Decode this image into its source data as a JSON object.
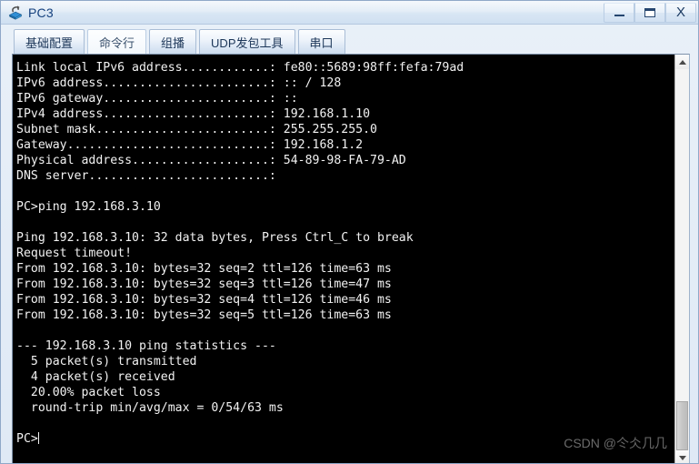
{
  "window": {
    "title": "PC3",
    "icon": "pc-device-icon",
    "controls": [
      {
        "name": "minimize-button",
        "label": "–",
        "icon": "minimize-icon"
      },
      {
        "name": "maximize-button",
        "label": "▭",
        "icon": "maximize-icon"
      },
      {
        "name": "close-button",
        "label": "X",
        "icon": "close-icon"
      }
    ]
  },
  "tabs": [
    {
      "label": "基础配置",
      "selected": false
    },
    {
      "label": "命令行",
      "selected": true
    },
    {
      "label": "组播",
      "selected": false
    },
    {
      "label": "UDP发包工具",
      "selected": false
    },
    {
      "label": "串口",
      "selected": false
    }
  ],
  "terminal": {
    "background": "#000000",
    "foreground": "#f2f2f2",
    "lines": [
      "Link local IPv6 address............: fe80::5689:98ff:fefa:79ad",
      "IPv6 address.......................: :: / 128",
      "IPv6 gateway.......................: ::",
      "IPv4 address.......................: 192.168.1.10",
      "Subnet mask........................: 255.255.255.0",
      "Gateway............................: 192.168.1.2",
      "Physical address...................: 54-89-98-FA-79-AD",
      "DNS server.........................:",
      "",
      "PC>ping 192.168.3.10",
      "",
      "Ping 192.168.3.10: 32 data bytes, Press Ctrl_C to break",
      "Request timeout!",
      "From 192.168.3.10: bytes=32 seq=2 ttl=126 time=63 ms",
      "From 192.168.3.10: bytes=32 seq=3 ttl=126 time=47 ms",
      "From 192.168.3.10: bytes=32 seq=4 ttl=126 time=46 ms",
      "From 192.168.3.10: bytes=32 seq=5 ttl=126 time=63 ms",
      "",
      "--- 192.168.3.10 ping statistics ---",
      "  5 packet(s) transmitted",
      "  4 packet(s) received",
      "  20.00% packet loss",
      "  round-trip min/avg/max = 0/54/63 ms",
      ""
    ],
    "prompt": "PC>"
  },
  "watermark": {
    "text": "CSDN @仒仌几几"
  },
  "scrollbar": {
    "up_label": "▲",
    "down_label": "▼"
  }
}
